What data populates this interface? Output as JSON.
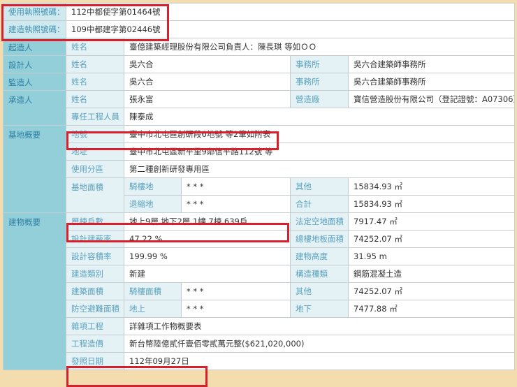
{
  "use_permit": {
    "label": "使用執照號碼：",
    "value": "112中都使字第01464號"
  },
  "build_permit": {
    "label": "建造執照號碼：",
    "value": "109中都建字第02446號"
  },
  "applicant": {
    "section": "起造人",
    "name_label": "姓名",
    "name": "臺億建築經理股份有限公司負責人：陳長琪 等如ＯＯ"
  },
  "designer": {
    "section": "設計人",
    "name_label": "姓名",
    "name": "吳六合",
    "office_label": "事務所",
    "office": "吳六合建築師事務所"
  },
  "supervisor": {
    "section": "監造人",
    "name_label": "姓名",
    "name": "吳六合",
    "office_label": "事務所",
    "office": "吳六合建築師事務所"
  },
  "contractor": {
    "section": "承造人",
    "name_label": "姓名",
    "name": "張永富",
    "company_label": "營造廠",
    "company": "寶信營造股份有限公司（登記證號：A07306）",
    "engineer_label": "專任工程人員",
    "engineer": "陳泰成"
  },
  "site": {
    "section": "基地概要",
    "lot_label": "地號",
    "lot": "臺中市北屯區創研段6地號 等2筆如附表",
    "address_label": "地址",
    "address": "臺中市北屯區新平里9鄰信平路112號 等",
    "zoning_label": "使用分區",
    "zoning": "第二種創新研發專用區",
    "area_label": "基地面積",
    "arcade_label": "騎樓地",
    "arcade": "* * *",
    "other_label": "其他",
    "other": "15834.93 ㎡",
    "setback_label": "退縮地",
    "setback": "* * *",
    "total_label": "合計",
    "total": "15834.93 ㎡"
  },
  "building": {
    "section": "建物概要",
    "floors_label": "層棟戶數",
    "floors": "地上9層 地下2層 1幢 7棟 639戶",
    "open_label": "法定空地面積",
    "open": "7917.47 ㎡",
    "coverage_label": "設計建蔽率",
    "coverage": "47.22 %",
    "floor_area_label": "總樓地板面積",
    "floor_area": "74252.07 ㎡",
    "far_label": "設計容積率",
    "far": "199.99 %",
    "height_label": "建物高度",
    "height": "31.95 m",
    "type_label": "建造類別",
    "type": "新建",
    "structure_label": "構造種類",
    "structure": "鋼筋混凝土造",
    "build_area_label": "建築面積",
    "arcade_area_label": "騎樓面積",
    "arcade_area": "* * *",
    "other_label": "其他",
    "other": "74252.07 ㎡",
    "shelter_label": "防空避難面積",
    "above_label": "地上",
    "above": "* * *",
    "below_label": "地下",
    "below": "7477.88 ㎡",
    "misc_label": "雜項工程",
    "misc": "詳雜項工作物概要表",
    "cost_label": "工程造價",
    "cost": "新台幣陸億貳仟壹佰零貳萬元整($621,020,000)",
    "date_label": "發照日期",
    "date": "112年09月27日"
  }
}
